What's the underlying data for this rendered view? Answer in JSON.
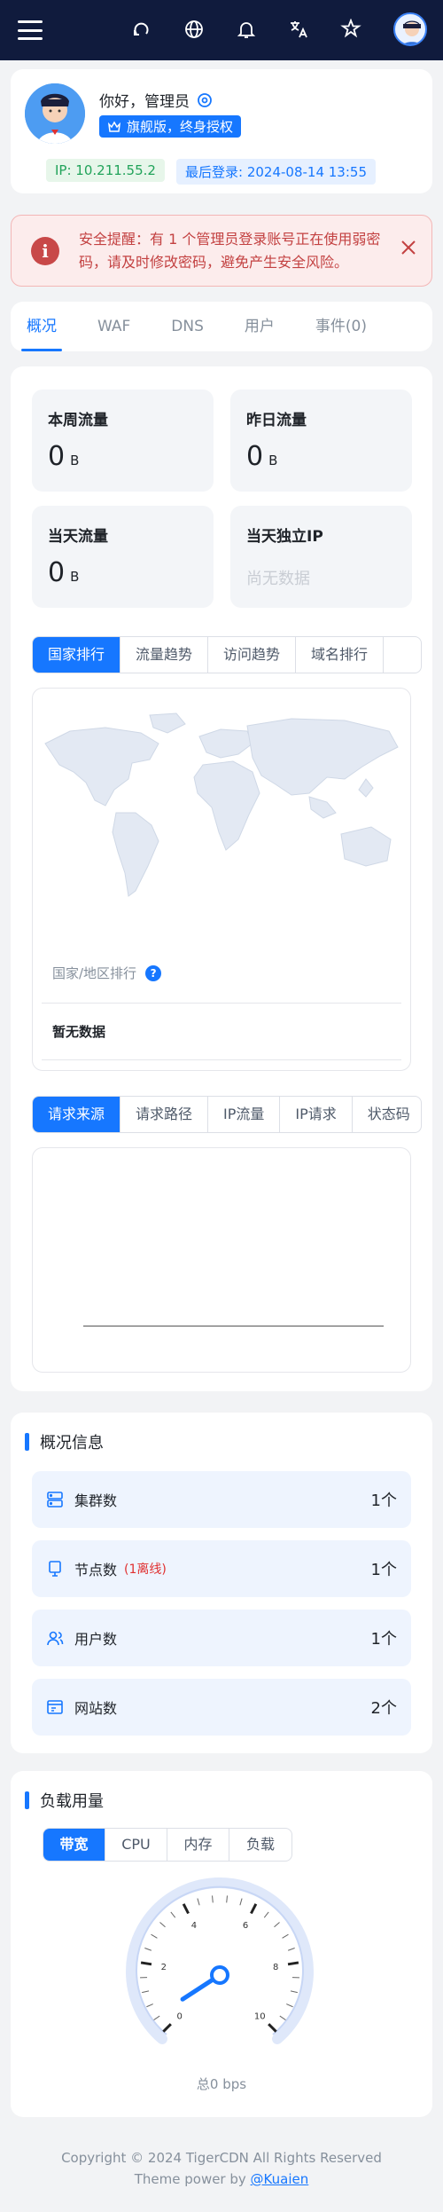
{
  "header": {
    "icons": [
      "menu-icon",
      "refresh-icon",
      "globe-icon",
      "bell-icon",
      "translate-icon",
      "theme-icon",
      "avatar"
    ]
  },
  "profile": {
    "greeting": "你好，管理员",
    "license": "旗舰版，终身授权",
    "ip": "IP: 10.211.55.2",
    "last_login": "最后登录: 2024-08-14 13:55"
  },
  "alert": {
    "text": "安全提醒：有 1 个管理员登录账号正在使用弱密码，请及时修改密码，避免产生安全风险。",
    "color": "#c34141"
  },
  "tabs": [
    {
      "label": "概况",
      "active": true
    },
    {
      "label": "WAF"
    },
    {
      "label": "DNS"
    },
    {
      "label": "用户"
    },
    {
      "label": "事件(0)"
    }
  ],
  "stats": {
    "week": {
      "title": "本周流量",
      "value": "0",
      "unit": "B"
    },
    "yesterday": {
      "title": "昨日流量",
      "value": "0",
      "unit": "B"
    },
    "today": {
      "title": "当天流量",
      "value": "0",
      "unit": "B"
    },
    "ip": {
      "title": "当天独立IP",
      "empty": "尚无数据"
    }
  },
  "chart_tabs_1": [
    "国家排行",
    "流量趋势",
    "访问趋势",
    "域名排行"
  ],
  "country_rank": {
    "title": "国家/地区排行",
    "help": "?",
    "empty": "暂无数据"
  },
  "chart_tabs_2": [
    "请求来源",
    "请求路径",
    "IP流量",
    "IP请求",
    "状态码"
  ],
  "overview": {
    "title": "概况信息",
    "rows": [
      {
        "label": "集群数",
        "count": "1个",
        "icon": "cluster-icon"
      },
      {
        "label": "节点数",
        "extra": "(1离线)",
        "count": "1个",
        "icon": "node-icon"
      },
      {
        "label": "用户数",
        "count": "1个",
        "icon": "users-icon"
      },
      {
        "label": "网站数",
        "count": "2个",
        "icon": "website-icon"
      }
    ]
  },
  "load": {
    "title": "负载用量",
    "tabs": [
      "带宽",
      "CPU",
      "内存",
      "负载"
    ],
    "gauge_ticks": [
      "0",
      "2",
      "4",
      "6",
      "8",
      "10"
    ],
    "total": "总0 bps",
    "value": 0
  },
  "footer": {
    "copyright": "Copyright © 2024 TigerCDN All Rights Reserved",
    "theme": "Theme power by ",
    "author": "@Kuaien"
  },
  "colors": {
    "primary": "#1677ff",
    "header": "#101b3d",
    "danger": "#c84848"
  }
}
